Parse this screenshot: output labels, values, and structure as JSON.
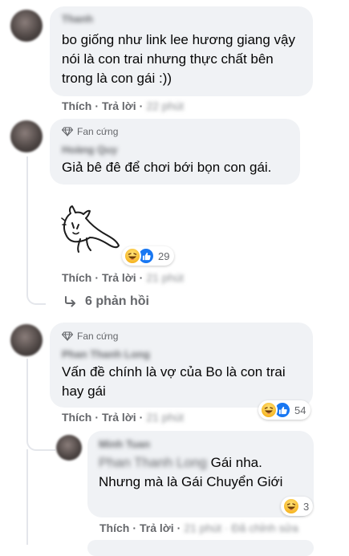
{
  "colors": {
    "bubble_bg": "#f0f2f5",
    "muted_text": "#65676b",
    "like_blue": "#1877f2",
    "haha_yellow": "#f7b928"
  },
  "comments": [
    {
      "author_blurred": "Thanh",
      "text": "bo giống như link lee hương giang vậy nói là con trai nhưng thực chất bên trong là con gái :))",
      "actions": {
        "like": "Thích",
        "reply": "Trả lời",
        "time_blurred": "22 phút"
      }
    },
    {
      "badge": "Fan cứng",
      "author_blurred": "Hoàng Quy",
      "text": "Giả bê đê để chơi bới bọn con gái.",
      "sticker": "peeking-cartoon-sticker",
      "reactions": {
        "icons": [
          "haha",
          "like"
        ],
        "count": "29"
      },
      "actions": {
        "like": "Thích",
        "reply": "Trả lời",
        "time_blurred": "21 phút"
      },
      "replies_link": "6 phản hồi"
    },
    {
      "badge": "Fan cứng",
      "author_blurred": "Phan Thanh Long",
      "text": "Vấn đề chính là vợ của Bo là con trai hay gái",
      "reactions": {
        "icons": [
          "haha",
          "like"
        ],
        "count": "54"
      },
      "actions": {
        "like": "Thích",
        "reply": "Trả lời",
        "time_blurred": "21 phút"
      }
    },
    {
      "author_blurred": "Minh Tuan",
      "mention_blurred": "Phan Thanh Long",
      "text_after_mention": " Gái nha.",
      "text_rest": "Nhưng mà là Gái Chuyển Giới",
      "reactions": {
        "icons": [
          "haha"
        ],
        "count": "3"
      },
      "actions": {
        "like": "Thích",
        "reply": "Trả lời",
        "time_blurred": "21 phút · Đã chỉnh sửa"
      }
    }
  ]
}
